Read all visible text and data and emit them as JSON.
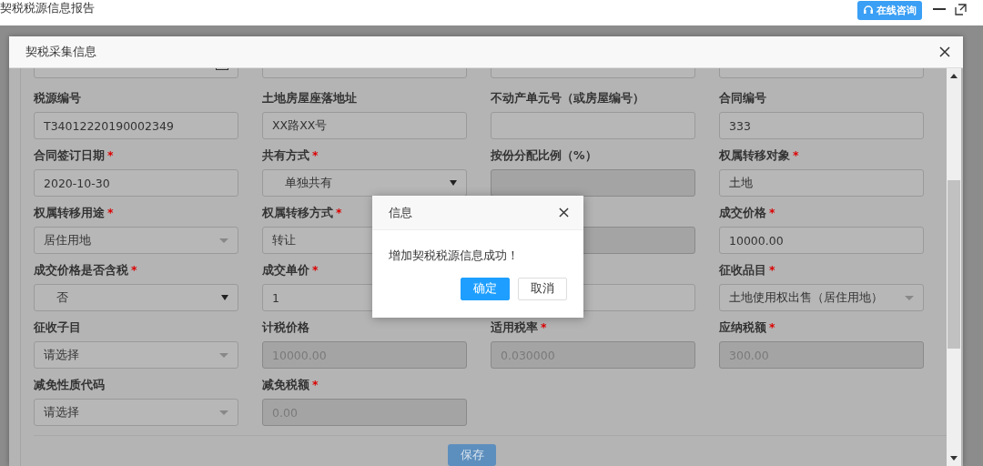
{
  "window": {
    "title": "契税税源信息报告",
    "consult_button": "在线咨询"
  },
  "modal": {
    "title": "契税采集信息",
    "partial_row": [
      {
        "kind": "date"
      },
      {
        "kind": "input"
      },
      {
        "kind": "input"
      },
      {
        "kind": "input"
      }
    ],
    "fields": [
      {
        "label": "税源编号",
        "kind": "input",
        "value": "T34012220190002349",
        "disabled": false
      },
      {
        "label": "土地房屋座落地址",
        "kind": "input",
        "value": "XX路XX号",
        "disabled": false
      },
      {
        "label": "不动产单元号（或房屋编号）",
        "kind": "input",
        "disabled": false
      },
      {
        "label": "合同编号",
        "kind": "input",
        "value": "333",
        "disabled": false
      },
      {
        "label": "合同签订日期",
        "required_mark": "*",
        "kind": "input",
        "value": "2020-10-30",
        "disabled": false
      },
      {
        "label": "共有方式",
        "required_mark": "*",
        "kind": "select",
        "value": "单独共有",
        "disabled": false
      },
      {
        "label": "按份分配比例（%）",
        "kind": "input",
        "disabled": true
      },
      {
        "label": "权属转移对象",
        "required_mark": "*",
        "kind": "input",
        "value": "土地",
        "disabled": false
      },
      {
        "label": "权属转移用途",
        "required_mark": "*",
        "kind": "combo",
        "value": "居住用地",
        "disabled": false
      },
      {
        "label": "权属转移方式",
        "required_mark": "*",
        "kind": "input",
        "value": "转让",
        "disabled": false
      },
      {
        "kind": "input",
        "disabled": true
      },
      {
        "label": "成交价格",
        "required_mark": "*",
        "kind": "input",
        "value": "10000.00",
        "disabled": false
      },
      {
        "label": "成交价格是否含税",
        "required_mark": "*",
        "kind": "select",
        "value": "否",
        "disabled": false
      },
      {
        "label": "成交单价",
        "required_mark": "*",
        "kind": "input",
        "value": "1",
        "disabled": false
      },
      {
        "kind": "input",
        "disabled": false
      },
      {
        "label": "征收品目",
        "required_mark": "*",
        "kind": "combo",
        "value": "土地使用权出售（居住用地）",
        "disabled": false
      },
      {
        "label": "征收子目",
        "kind": "combo",
        "value": "请选择",
        "disabled": false
      },
      {
        "label": "计税价格",
        "kind": "input",
        "value": "10000.00",
        "disabled": true
      },
      {
        "label": "适用税率",
        "required_mark": "*",
        "kind": "input",
        "value": "0.030000",
        "disabled": true
      },
      {
        "label": "应纳税额",
        "required_mark": "*",
        "kind": "input",
        "value": "300.00",
        "disabled": true
      },
      {
        "label": "减免性质代码",
        "kind": "combo",
        "value": "请选择",
        "disabled": false
      },
      {
        "label": "减免税额",
        "required_mark": "*",
        "kind": "input",
        "value": "0.00",
        "disabled": true
      }
    ],
    "save_button": "保存"
  },
  "dialog": {
    "title": "信息",
    "message": "增加契税税源信息成功！",
    "buttons": [
      {
        "label": "确定",
        "primary": true
      },
      {
        "label": "取消",
        "primary": false
      }
    ]
  }
}
